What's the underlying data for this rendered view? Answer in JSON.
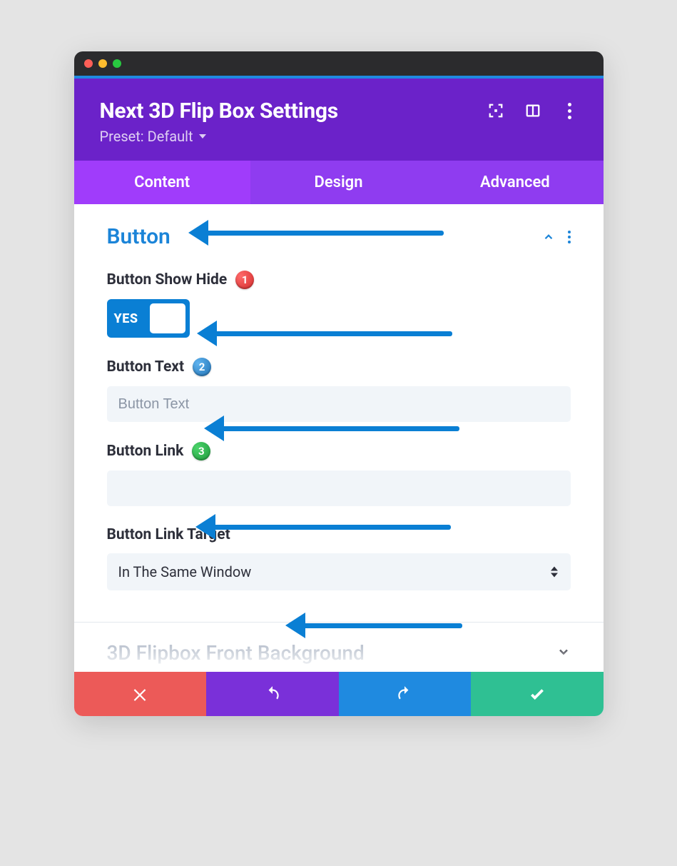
{
  "header": {
    "title": "Next 3D Flip Box Settings",
    "preset": "Preset: Default"
  },
  "tabs": [
    {
      "label": "Content",
      "active": true
    },
    {
      "label": "Design",
      "active": false
    },
    {
      "label": "Advanced",
      "active": false
    }
  ],
  "section": {
    "title": "Button",
    "fields": {
      "show_hide": {
        "label": "Button Show Hide",
        "badge": "1",
        "toggle": "YES"
      },
      "text": {
        "label": "Button Text",
        "badge": "2",
        "placeholder": "Button Text",
        "value": ""
      },
      "link": {
        "label": "Button Link",
        "badge": "3",
        "value": ""
      },
      "target": {
        "label": "Button Link Target",
        "value": "In The Same Window"
      }
    }
  },
  "collapsed_section": {
    "title": "3D Flipbox Front Background"
  }
}
